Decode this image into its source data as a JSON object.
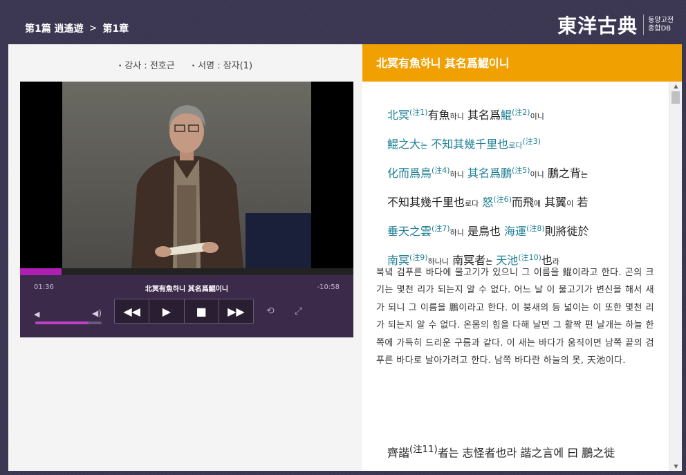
{
  "breadcrumb": {
    "part": "第1篇 逍遙遊",
    "separator": ">",
    "chapter": "第1章"
  },
  "logo": {
    "title": "東洋古典",
    "sub1": "동양고전",
    "sub2": "종합DB"
  },
  "meta": {
    "lecturer": "강사 : 전호근",
    "book": "서명 : 장자(1)"
  },
  "player": {
    "elapsed": "01:36",
    "remaining": "-10:58",
    "now_title": "北冥有魚하니 其名爲鯤이니",
    "progress": 0.125,
    "volume": 0.8,
    "icons": {
      "vol_low": "volume-low-icon",
      "vol_high": "volume-high-icon",
      "rewind": "rewind-icon",
      "play": "play-icon",
      "stop": "stop-icon",
      "forward": "fast-forward-icon",
      "repeat": "repeat-icon",
      "fullscreen": "fullscreen-icon"
    }
  },
  "right": {
    "header": "北冥有魚하니 其名爲鯤이니",
    "classic_lines": [
      [
        {
          "t": "北冥",
          "c": "cy"
        },
        {
          "t": "(注1)",
          "c": "sup"
        },
        {
          "t": "有魚"
        },
        {
          "t": "하니",
          "c": "small"
        },
        {
          "t": " 其名爲"
        },
        {
          "t": "鯤",
          "c": "cy"
        },
        {
          "t": "(注2)",
          "c": "sup"
        },
        {
          "t": "이니",
          "c": "small"
        }
      ],
      [
        {
          "t": "鯤之大",
          "c": "cy"
        },
        {
          "t": "는",
          "c": "small cy"
        },
        {
          "t": " 不知其幾千里也",
          "c": "cy"
        },
        {
          "t": "로다",
          "c": "small cy"
        },
        {
          "t": "(注3)",
          "c": "sup"
        }
      ],
      [
        {
          "t": "化而爲鳥",
          "c": "cy"
        },
        {
          "t": "(注4)",
          "c": "sup"
        },
        {
          "t": "하니",
          "c": "small"
        },
        {
          "t": " 其名爲鵬",
          "c": "cy"
        },
        {
          "t": "(注5)",
          "c": "sup"
        },
        {
          "t": "이니",
          "c": "small"
        },
        {
          "t": " 鵬之背"
        },
        {
          "t": "는",
          "c": "small"
        }
      ],
      [
        {
          "t": "不知其幾千里也"
        },
        {
          "t": "로다",
          "c": "small"
        },
        {
          "t": " 怒",
          "c": "cy"
        },
        {
          "t": "(注6)",
          "c": "sup"
        },
        {
          "t": "而飛"
        },
        {
          "t": "에",
          "c": "small"
        },
        {
          "t": " 其翼"
        },
        {
          "t": "이",
          "c": "small"
        },
        {
          "t": " 若"
        }
      ],
      [
        {
          "t": "垂天之雲",
          "c": "cy"
        },
        {
          "t": "(注7)",
          "c": "sup"
        },
        {
          "t": "하니",
          "c": "small"
        },
        {
          "t": " 是鳥也 "
        },
        {
          "t": "海運",
          "c": "cy"
        },
        {
          "t": "(注8)",
          "c": "sup"
        },
        {
          "t": "則將徙於"
        }
      ],
      [
        {
          "t": "南冥",
          "c": "cy"
        },
        {
          "t": "(注9)",
          "c": "sup"
        },
        {
          "t": "하나니",
          "c": "small"
        },
        {
          "t": " 南冥者"
        },
        {
          "t": "는",
          "c": "small"
        },
        {
          "t": " "
        },
        {
          "t": "天池",
          "c": "cy"
        },
        {
          "t": "(注10)",
          "c": "sup"
        },
        {
          "t": "也"
        },
        {
          "t": "라",
          "c": "small"
        }
      ]
    ],
    "translation": "북녘 검푸른 바다에 물고기가 있으니 그 이름을 鯤이라고 한다. 곤의 크기는 몇천 리가 되는지 알 수 없다. 어느 날 이 물고기가 변신을 해서 새가 되니 그 이름을 鵬이라고 한다. 이 붕새의 등 넓이는 이 또한 몇천 리가 되는지 알 수 없다. 온몸의 힘을 다해 날면 그 활짝 편 날개는 하늘 한쪽에 가득히 드리운 구름과 같다. 이 새는 바다가 움직이면 남쪽 끝의 검푸른 바다로 날아가려고 한다. 남쪽 바다란 하늘의 못, 天池이다.",
    "classic2_lines": [
      [
        {
          "t": "齊諧",
          "c": "cy"
        },
        {
          "t": "(注11)",
          "c": "sup"
        },
        {
          "t": "者"
        },
        {
          "t": "는",
          "c": "small"
        },
        {
          "t": " 志怪者也"
        },
        {
          "t": "라",
          "c": "small"
        },
        {
          "t": " 諧之言"
        },
        {
          "t": "에",
          "c": "small"
        },
        {
          "t": " 曰 鵬之徙"
        }
      ]
    ]
  }
}
